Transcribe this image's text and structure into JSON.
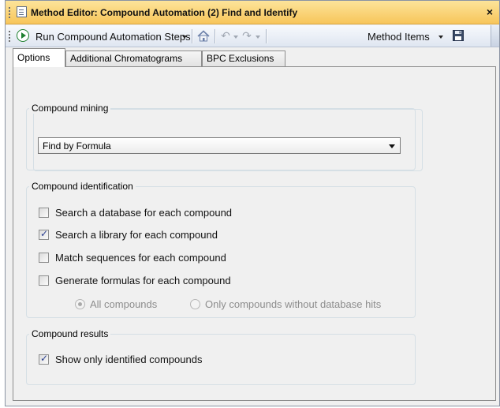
{
  "window": {
    "title": "Method Editor: Compound Automation (2) Find and Identify",
    "close_glyph": "×"
  },
  "toolbar": {
    "run_label": "Run Compound Automation Steps",
    "method_items_label": "Method Items",
    "icons": [
      "play-icon",
      "home-icon",
      "undo-icon",
      "redo-icon",
      "save-icon"
    ]
  },
  "tabs": [
    {
      "label": "Options",
      "active": true
    },
    {
      "label": "Additional Chromatograms",
      "active": false
    },
    {
      "label": "BPC Exclusions",
      "active": false
    }
  ],
  "mining": {
    "title": "Compound mining",
    "selected": "Find by Formula"
  },
  "identification": {
    "title": "Compound identification",
    "options": [
      {
        "label": "Search a database for each compound",
        "checked": false
      },
      {
        "label": "Search a library for each compound",
        "checked": true
      },
      {
        "label": "Match sequences for each compound",
        "checked": false
      },
      {
        "label": "Generate formulas for each compound",
        "checked": false
      }
    ],
    "radios": [
      {
        "label": "All compounds",
        "checked": true,
        "enabled": false
      },
      {
        "label": "Only compounds without database hits",
        "checked": false,
        "enabled": false
      }
    ]
  },
  "results": {
    "title": "Compound results",
    "show_identified_label": "Show only identified compounds",
    "show_identified_checked": true
  },
  "colors": {
    "title_bar": "#f7c55a",
    "toolbar": "#dfe6f1",
    "panel": "#f0f0f0",
    "checkmark": "#2a3f8f",
    "run_icon": "#1d7f2e"
  }
}
